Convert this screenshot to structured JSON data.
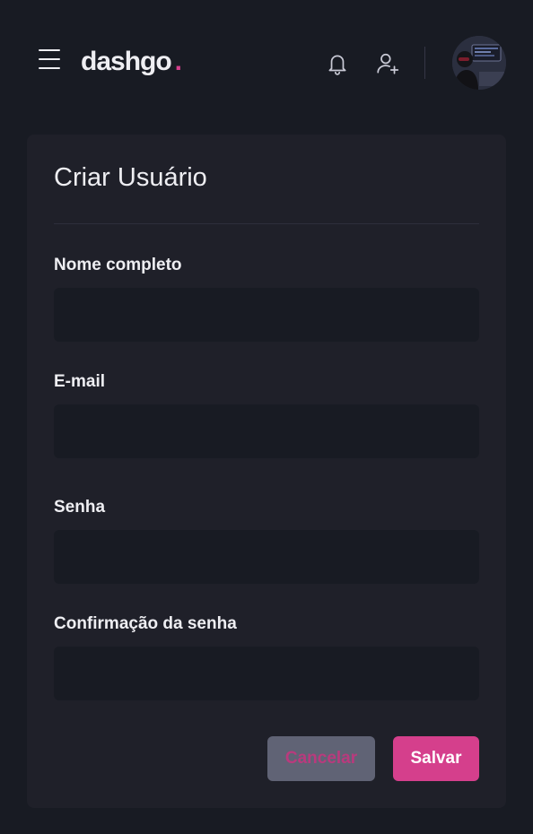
{
  "header": {
    "logo_text": "dashgo",
    "logo_dot": ".",
    "icons": [
      "menu-icon",
      "bell-icon",
      "user-add-icon"
    ],
    "accent_color": "#d53f8c"
  },
  "form": {
    "title": "Criar Usuário",
    "fields": [
      {
        "label": "Nome completo",
        "value": "",
        "placeholder": ""
      },
      {
        "label": "E-mail",
        "value": "",
        "placeholder": ""
      },
      {
        "label": "Senha",
        "value": "",
        "placeholder": ""
      },
      {
        "label": "Confirmação da senha",
        "value": "",
        "placeholder": ""
      }
    ],
    "cancel_label": "Cancelar",
    "save_label": "Salvar"
  }
}
